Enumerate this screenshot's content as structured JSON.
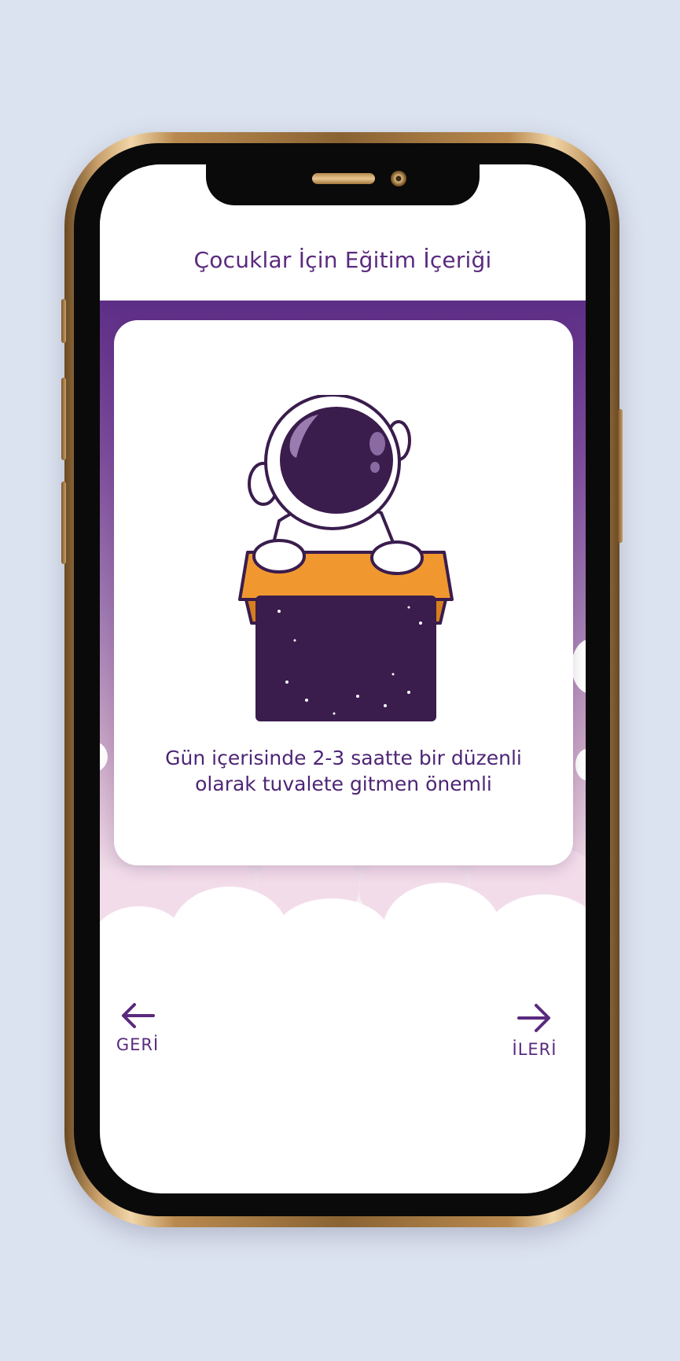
{
  "header": {
    "title": "Çocuklar İçin Eğitim İçeriği"
  },
  "card": {
    "text": "Gün içerisinde 2-3 saatte bir düzenli olarak tuvalete gitmen önemli"
  },
  "navigation": {
    "back": {
      "label": "GERİ",
      "icon": "arrow-left-icon"
    },
    "next": {
      "label": "İLERİ",
      "icon": "arrow-right-icon"
    }
  },
  "colors": {
    "accent": "#5a2a7e",
    "background": "#dce3f0",
    "box_orange": "#f0982f",
    "astronaut_dark": "#3a1c4d"
  }
}
